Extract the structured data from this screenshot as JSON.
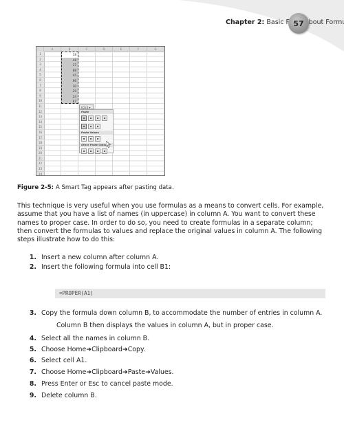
{
  "header": {
    "chapter_label": "Chapter 2:",
    "chapter_title": "Basic Facts about Formulas",
    "page_number": "57"
  },
  "figure": {
    "spreadsheet": {
      "columns": [
        "A",
        "B",
        "C",
        "D",
        "E",
        "F",
        "G"
      ],
      "rows": [
        "1",
        "2",
        "3",
        "4",
        "5",
        "6",
        "7",
        "8",
        "9",
        "10",
        "11",
        "12",
        "13",
        "14",
        "15",
        "16",
        "17",
        "18",
        "19",
        "20",
        "21",
        "22",
        "23",
        "24"
      ],
      "column_b_values": [
        "18",
        "48",
        "37",
        "88",
        "45",
        "96",
        "30",
        "29",
        "24",
        "87"
      ],
      "smart_tag_label": "(Ctrl) ▾",
      "paste_menu": {
        "sections": [
          {
            "title": "Paste",
            "icon_rows": [
              [
                "paste",
                "formulas",
                "formulas-number-format",
                "keep-source-formatting"
              ],
              [
                "no-borders",
                "keep-column-widths",
                "transpose"
              ]
            ]
          },
          {
            "title": "Paste Values",
            "icon_rows": [
              [
                "values",
                "values-number-format",
                "values-source-formatting"
              ]
            ]
          },
          {
            "title": "Other Paste Options",
            "icon_rows": [
              [
                "formatting",
                "paste-link",
                "picture",
                "linked-picture"
              ]
            ]
          }
        ]
      }
    },
    "caption_label": "Figure 2-5:",
    "caption_text": "A Smart Tag appears after pasting data."
  },
  "body": {
    "paragraph": "This technique is very useful when you use formulas as a means to convert cells. For example, assume that you have a list of names (in uppercase) in column A. You want to convert these names to proper case. In order to do so, you need to create formulas in a separate column; then convert the formulas to values and replace the original values in column A. The following steps illustrate how to do this:",
    "steps": [
      {
        "num": "1.",
        "text": "Insert a new column after column A."
      },
      {
        "num": "2.",
        "text": "Insert the following formula into cell B1:"
      },
      {
        "num": "3.",
        "text": "Copy the formula down column B, to accommodate the number of entries in column A."
      },
      {
        "num": "4.",
        "text": "Select all the names in column B."
      },
      {
        "num": "5.",
        "text": "Choose Home➜Clipboard➜Copy."
      },
      {
        "num": "6.",
        "text": "Select cell A1."
      },
      {
        "num": "7.",
        "text": "Choose Home➜Clipboard➜Paste➜Values."
      },
      {
        "num": "8.",
        "text": "Press Enter or Esc to cancel paste mode."
      },
      {
        "num": "9.",
        "text": "Delete column B."
      }
    ],
    "code": "=PROPER(A1)",
    "step3_continuation": "Column B then displays the values in column A, but in proper case."
  }
}
